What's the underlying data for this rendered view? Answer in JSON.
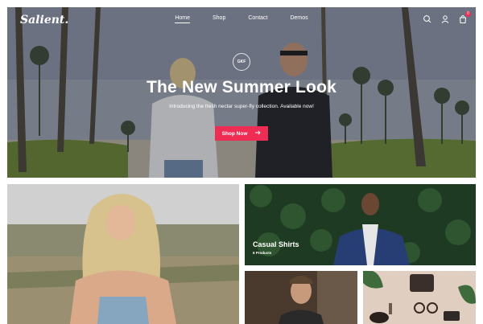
{
  "header": {
    "logo": "Salient.",
    "nav": [
      {
        "label": "Home",
        "active": true
      },
      {
        "label": "Shop",
        "active": false
      },
      {
        "label": "Contact",
        "active": false
      },
      {
        "label": "Demos",
        "active": false
      }
    ],
    "icons": [
      "search-icon",
      "user-icon",
      "cart-icon"
    ],
    "cart_count": "0"
  },
  "hero": {
    "badge": "GKF",
    "title": "The New Summer Look",
    "subtitle": "Introducing the fresh nectar super-fly collection. Available now!",
    "button_label": "Shop Now",
    "button_icon": "arrow-right-icon"
  },
  "categories": [
    {
      "title": "Casual Shirts",
      "count": "6 Products"
    }
  ],
  "colors": {
    "accent": "#ee2c54",
    "text_light": "#ffffff"
  }
}
